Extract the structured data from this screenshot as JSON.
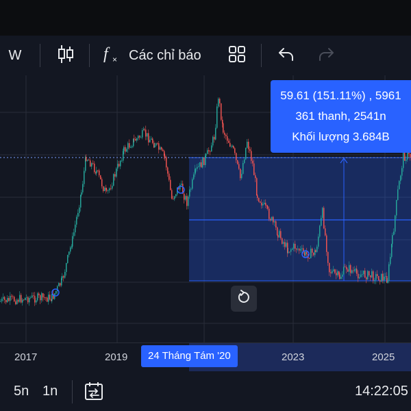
{
  "toolbar": {
    "interval": "W",
    "indicators_label": "Các chỉ báo"
  },
  "tooltip": {
    "line1": "59.61 (151.11%) , 5961",
    "line2": "361 thanh, 2541n",
    "line3": "Khối lượng 3.684B"
  },
  "time_axis": {
    "labels": [
      "2017",
      "2019",
      "2023",
      "2025"
    ],
    "cursor_label": "24 Tháng Tám '20"
  },
  "bottombar": {
    "range_5y": "5n",
    "range_1y": "1n",
    "clock": "14:22:05"
  },
  "colors": {
    "up": "#26a69a",
    "down": "#ef5350",
    "accent": "#2962ff",
    "background": "#131722"
  },
  "icons": [
    "candlestick-icon",
    "function-icon",
    "layout-grid-icon",
    "undo-icon",
    "redo-icon",
    "reset-icon",
    "date-range-icon"
  ]
}
